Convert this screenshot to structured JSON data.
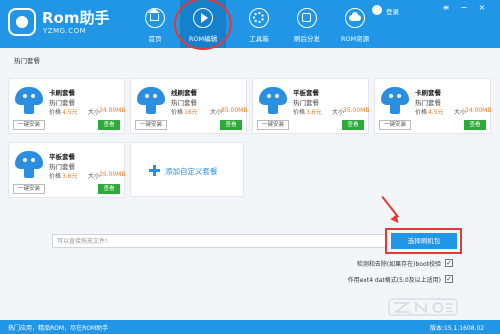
{
  "header": {
    "app_title": "Rom助手",
    "app_subtitle": "YZMG.COM",
    "nav": [
      {
        "label": "首页",
        "icon": "home-icon"
      },
      {
        "label": "ROM编辑",
        "icon": "play-icon"
      },
      {
        "label": "工具箱",
        "icon": "gear-icon"
      },
      {
        "label": "刷后分发",
        "icon": "share-icon"
      },
      {
        "label": "ROM资源",
        "icon": "cloud-icon"
      }
    ],
    "user_label": "登录",
    "controls": [
      "≡",
      "−",
      "×"
    ]
  },
  "section_title": "热门套餐",
  "cards": [
    {
      "name": "卡刷套餐",
      "tag": "热门套餐",
      "price_label": "价格",
      "price": "4.5元",
      "size_label": "大小",
      "size": "34.00MB",
      "install_label": "一键安装",
      "view_label": "查看"
    },
    {
      "name": "线刷套餐",
      "tag": "热门套餐",
      "price_label": "价格",
      "price": "16元",
      "size_label": "大小",
      "size": "85.00MB",
      "install_label": "一键安装",
      "view_label": "查看"
    },
    {
      "name": "平板套餐",
      "tag": "热门套餐",
      "price_label": "价格",
      "price": "3.6元",
      "size_label": "大小",
      "size": "35.00MB",
      "install_label": "一键安装",
      "view_label": "查看"
    },
    {
      "name": "卡刷套餐",
      "tag": "热门套餐",
      "price_label": "价格",
      "price": "4.5元",
      "size_label": "大小",
      "size": "34.00MB",
      "install_label": "一键安装",
      "view_label": "查看"
    },
    {
      "name": "平板套餐",
      "tag": "热门套餐",
      "price_label": "价格",
      "price": "3.6元",
      "size_label": "大小",
      "size": "35.00MB",
      "install_label": "一键安装",
      "view_label": "查看"
    }
  ],
  "add_package_label": "添加自定义套餐",
  "file_input": {
    "placeholder": "可以直接拖放文件！",
    "value": ""
  },
  "choose_button_label": "选择刷机包",
  "options": [
    {
      "label": "检测和去除(如果存在)boot校验",
      "checked": true
    },
    {
      "label": "作用ext4 dat格式(5.0及以上适用)",
      "checked": true
    }
  ],
  "status": {
    "left": "热门应用，精品ROM，尽在ROM助手",
    "version": "版本:15.1.1608.02"
  },
  "colors": {
    "primary": "#2196e6",
    "accent_orange": "#f07b1d",
    "view_green": "#2eaa3a",
    "annotation_red": "#e53935"
  }
}
